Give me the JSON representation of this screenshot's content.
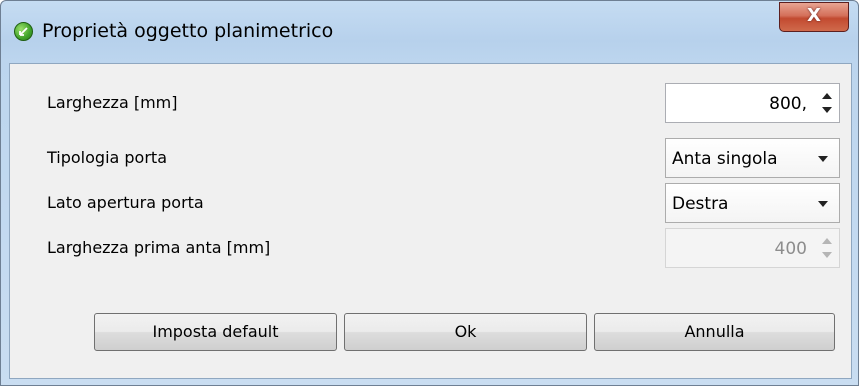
{
  "window": {
    "title": "Proprietà oggetto planimetrico",
    "close_label": "X"
  },
  "form": {
    "width_label": "Larghezza [mm]",
    "width_value": "800,",
    "door_type_label": "Tipologia porta",
    "door_type_value": "Anta singola",
    "opening_side_label": "Lato apertura porta",
    "opening_side_value": "Destra",
    "first_leaf_width_label": "Larghezza prima anta [mm]",
    "first_leaf_width_value": "400"
  },
  "buttons": {
    "default_label": "Imposta default",
    "ok_label": "Ok",
    "cancel_label": "Annulla"
  },
  "icons": {
    "app": "green-circle-app-icon",
    "close": "close-icon",
    "spin": "spin-up-down-icon",
    "dropdown": "chevron-down-icon"
  }
}
